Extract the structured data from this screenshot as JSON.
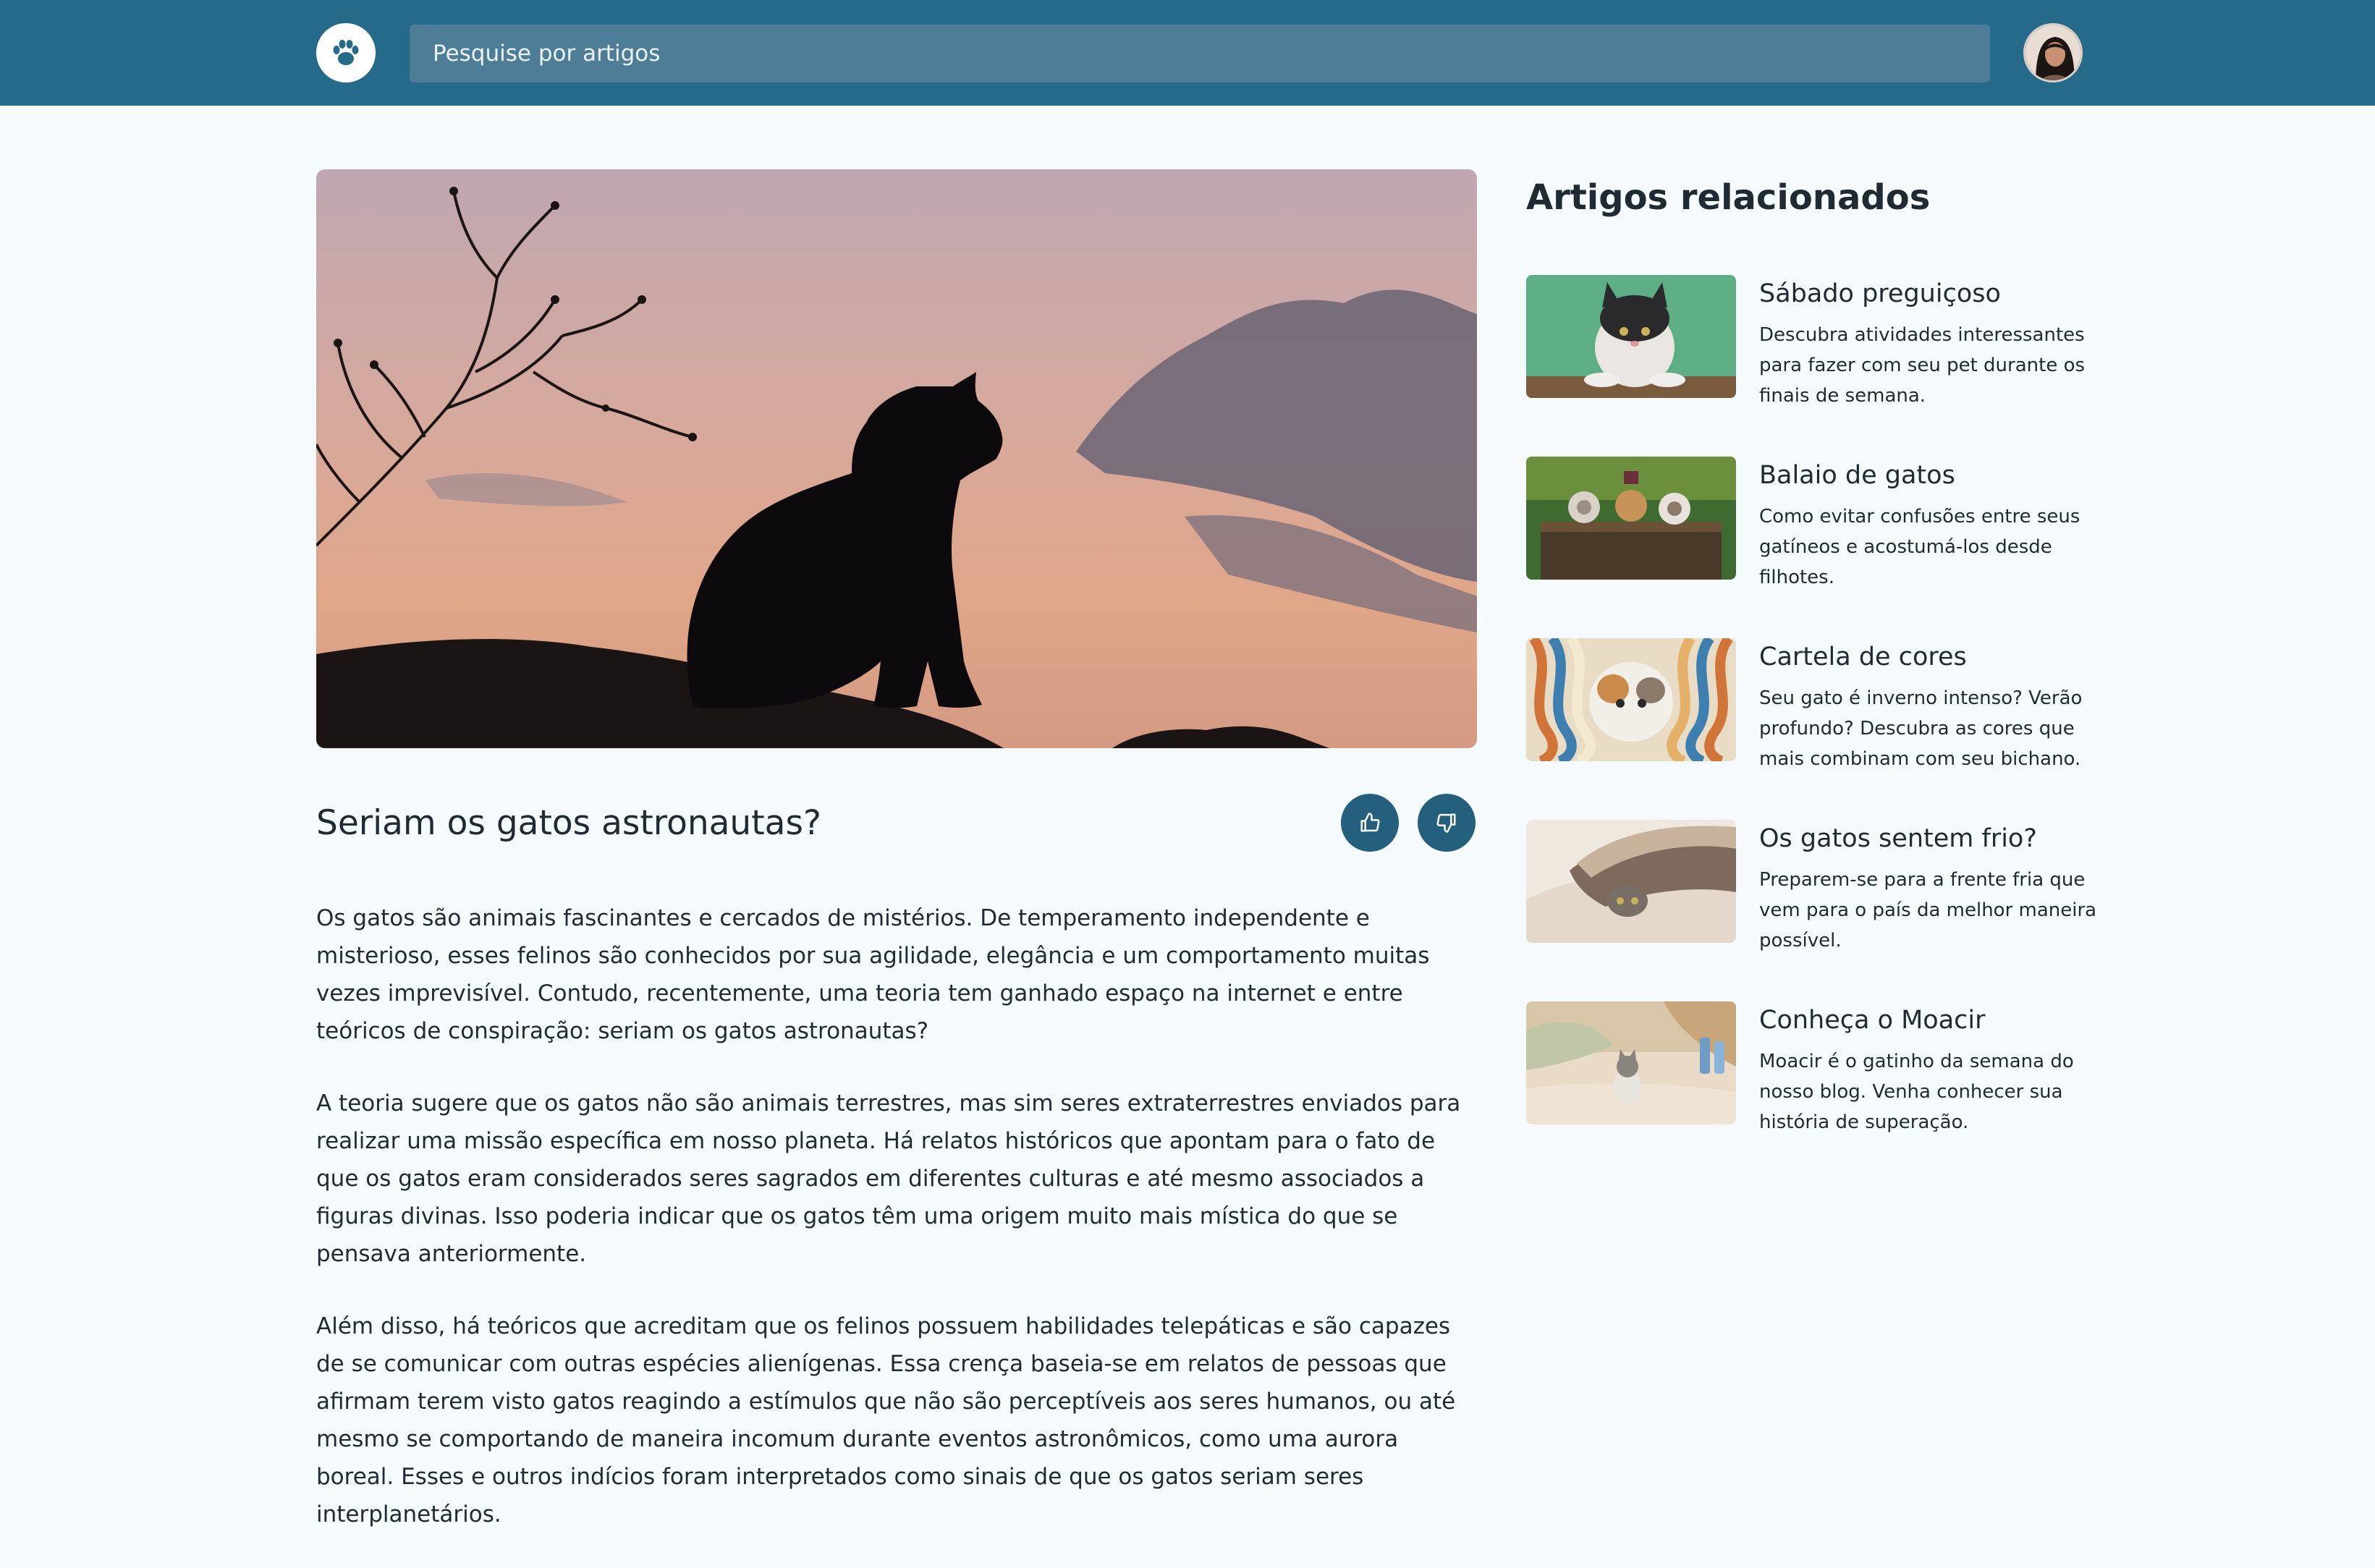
{
  "header": {
    "search_placeholder": "Pesquise por artigos",
    "logo_icon": "paw-icon",
    "brand_color": "#256A89"
  },
  "article": {
    "title": "Seriam os gatos astronautas?",
    "paragraphs": [
      "Os gatos são animais fascinantes e cercados de mistérios. De temperamento independente e misterioso, esses felinos são conhecidos por sua agilidade, elegância e um comportamento muitas vezes imprevisível. Contudo, recentemente, uma teoria tem ganhado espaço na internet e entre teóricos de conspiração: seriam os gatos astronautas?",
      "A teoria sugere que os gatos não são animais terrestres, mas sim seres extraterrestres enviados para realizar uma missão específica em nosso planeta. Há relatos históricos que apontam para o fato de que os gatos eram considerados seres sagrados em diferentes culturas e até mesmo associados a figuras divinas. Isso poderia indicar que os gatos têm uma origem muito mais mística do que se pensava anteriormente.",
      "Além disso, há teóricos que acreditam que os felinos possuem habilidades telepáticas e são capazes de se comunicar com outras espécies alienígenas. Essa crença baseia-se em relatos de pessoas que afirmam terem visto gatos reagindo a estímulos que não são perceptíveis aos seres humanos, ou até mesmo se comportando de maneira incomum durante eventos astronômicos, como uma aurora boreal. Esses e outros indícios foram interpretados como sinais de que os gatos seriam seres interplanetários."
    ],
    "like_icon": "thumbs-up-icon",
    "dislike_icon": "thumbs-down-icon"
  },
  "sidebar": {
    "title": "Artigos relacionados",
    "items": [
      {
        "title": "Sábado preguiçoso",
        "description": "Descubra atividades interessantes para fazer com seu pet durante os finais de semana."
      },
      {
        "title": "Balaio de gatos",
        "description": "Como evitar confusões entre seus gatíneos e acostumá-los desde filhotes."
      },
      {
        "title": "Cartela de cores",
        "description": "Seu gato é inverno intenso? Verão profundo? Descubra as cores que mais combinam com seu bichano."
      },
      {
        "title": "Os gatos sentem frio?",
        "description": "Preparem-se para a frente fria que vem para o país da melhor maneira possível."
      },
      {
        "title": "Conheça o Moacir",
        "description": "Moacir é o gatinho da semana do nosso blog. Venha conhecer sua história de superação."
      }
    ]
  }
}
